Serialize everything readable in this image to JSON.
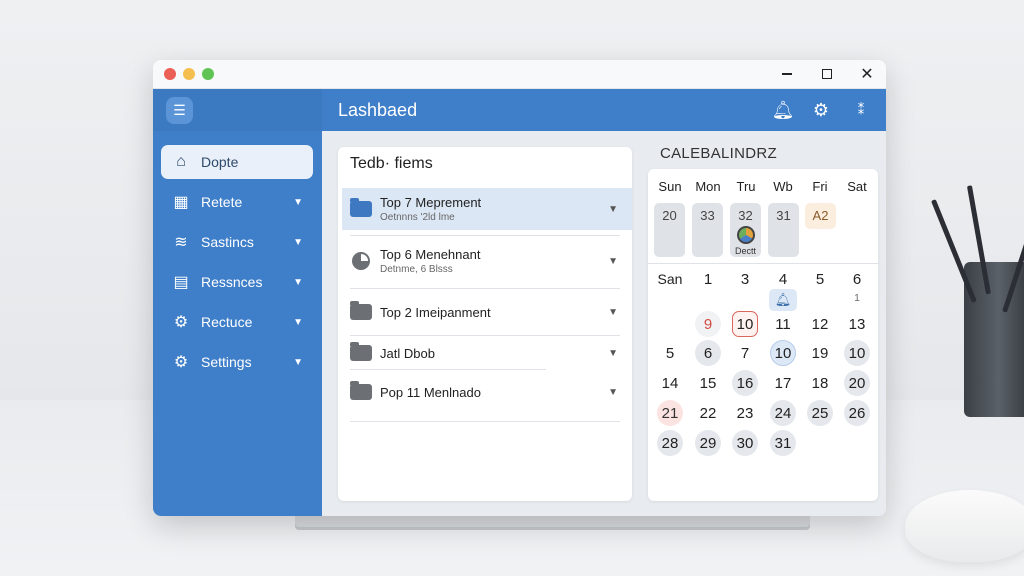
{
  "window": {
    "controls": {
      "close_color": "#ec5f57",
      "minimize_color": "#f5bf4f",
      "maximize_color": "#5fc454"
    }
  },
  "header": {
    "title": "Lashbaed",
    "accent": "#3f7fc9",
    "icons": [
      "bell-icon",
      "gear-icon",
      "more-icon"
    ]
  },
  "sidebar": {
    "items": [
      {
        "label": "Dopte",
        "icon": "home-icon",
        "active": true
      },
      {
        "label": "Retete",
        "icon": "grid-icon",
        "active": false
      },
      {
        "label": "Sastincs",
        "icon": "layers-icon",
        "active": false
      },
      {
        "label": "Ressnces",
        "icon": "document-icon",
        "active": false
      },
      {
        "label": "Rectuce",
        "icon": "gear-icon",
        "active": false
      },
      {
        "label": "Settings",
        "icon": "gear-icon",
        "active": false
      }
    ]
  },
  "list": {
    "title": "Tedb· fiems",
    "rows": [
      {
        "title": "Top 7 Meprement",
        "subtitle": "Oetnnns '2ld lme",
        "icon": "folder-icon",
        "selected": true
      },
      {
        "title": "Top 6 Menehnant",
        "subtitle": "Detnme, 6 Blsss",
        "icon": "pie-chart-icon",
        "selected": false
      },
      {
        "title": "Top 2 Imeipanment",
        "subtitle": "",
        "icon": "folder-icon",
        "selected": false
      },
      {
        "title": "Jatl Dbob",
        "subtitle": "",
        "icon": "folder-icon",
        "selected": false
      },
      {
        "title": "Pop 11 Menlnado",
        "subtitle": "",
        "icon": "folder-icon",
        "selected": false
      }
    ]
  },
  "calendar": {
    "title": "CALEBALINDRZ",
    "weekdays": [
      "Sun",
      "Mon",
      "Tru",
      "Wb",
      "Fri",
      "Sat"
    ],
    "top_cells": [
      "20",
      "33",
      "32",
      "31",
      "A2"
    ],
    "top_caption": "Dectt",
    "week_header": [
      "San",
      "1",
      "3",
      "4",
      "5",
      "6"
    ],
    "extra_small": "1",
    "rows": [
      [
        "9",
        "10",
        "11",
        "12",
        "13"
      ],
      [
        "5",
        "6",
        "7",
        "10",
        "19",
        "10"
      ],
      [
        "14",
        "15",
        "16",
        "17",
        "18",
        "20"
      ],
      [
        "21",
        "22",
        "23",
        "24",
        "25",
        "26"
      ],
      [
        "28",
        "29",
        "30",
        "31"
      ]
    ]
  }
}
